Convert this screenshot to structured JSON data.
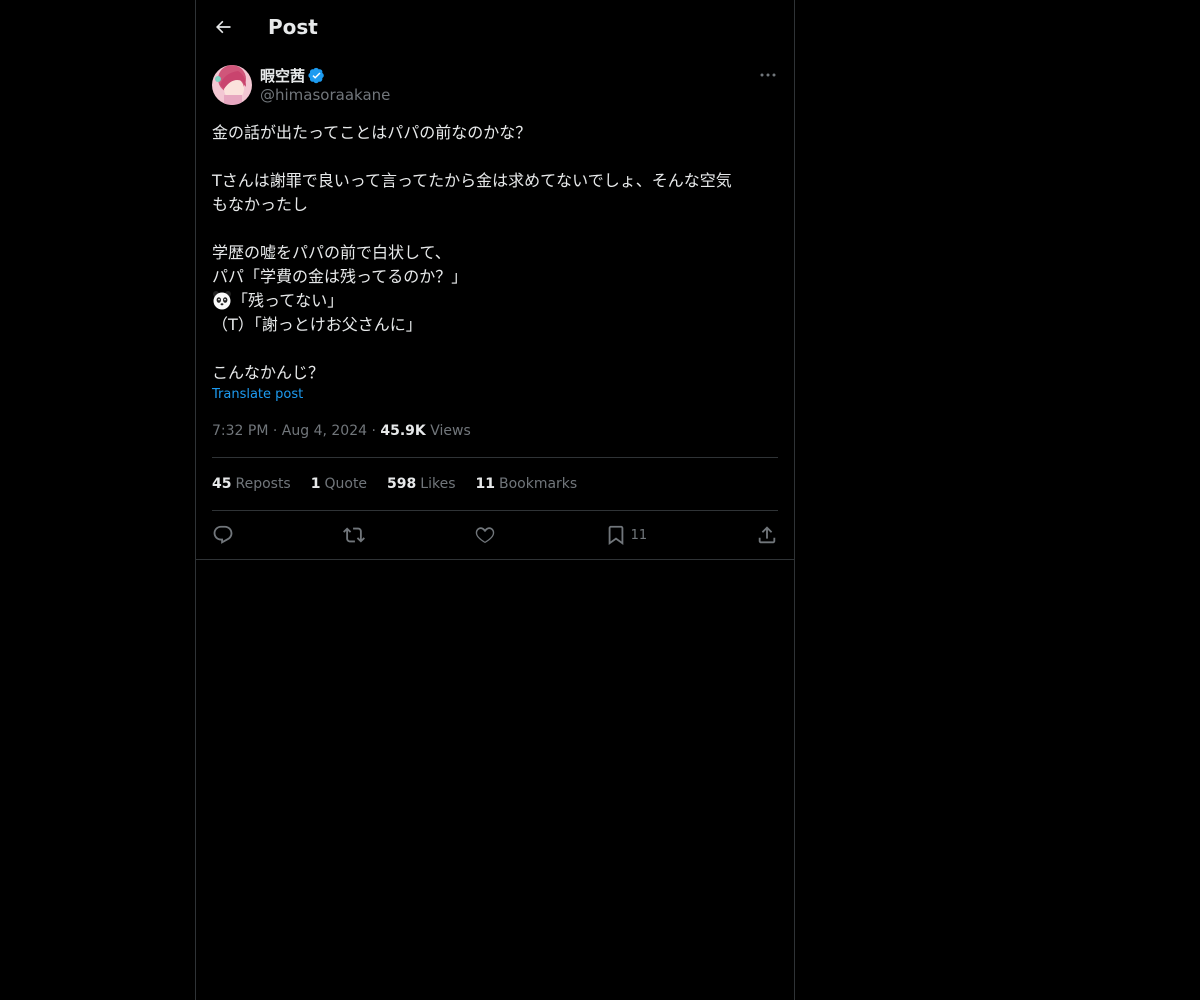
{
  "header": {
    "title": "Post"
  },
  "post": {
    "author": {
      "name": "暇空茜",
      "handle": "@himasoraakane",
      "verified": true
    },
    "lines": [
      "金の話が出たってことはパパの前なのかな？",
      "",
      "Tさんは謝罪で良いって言ってたから金は求めてないでしょ、そんな空気",
      "もなかったし",
      "",
      "学歴の嘘をパパの前で白状して、",
      "パパ「学費の金は残ってるのか？」",
      "「残ってない」",
      "（T）「謝っとけお父さんに」",
      "",
      "こんなかんじ？"
    ],
    "translate": "Translate post",
    "time": "7:32 PM",
    "date": "Aug 4, 2024",
    "views_count": "45.9K",
    "views_label": "Views"
  },
  "stats": {
    "reposts_count": "45",
    "reposts_label": "Reposts",
    "quotes_count": "1",
    "quotes_label": "Quote",
    "likes_count": "598",
    "likes_label": "Likes",
    "bookmarks_count": "11",
    "bookmarks_label": "Bookmarks"
  },
  "actions": {
    "bookmark_count": "11"
  },
  "colors": {
    "accent": "#1d9bf0",
    "muted": "#71767b",
    "text": "#e7e9ea",
    "border": "#2f3336"
  },
  "icons": [
    "back-arrow-icon",
    "verified-badge-icon",
    "more-icon",
    "panda-emoji-icon",
    "reply-icon",
    "repost-icon",
    "like-icon",
    "bookmark-icon",
    "share-icon"
  ]
}
